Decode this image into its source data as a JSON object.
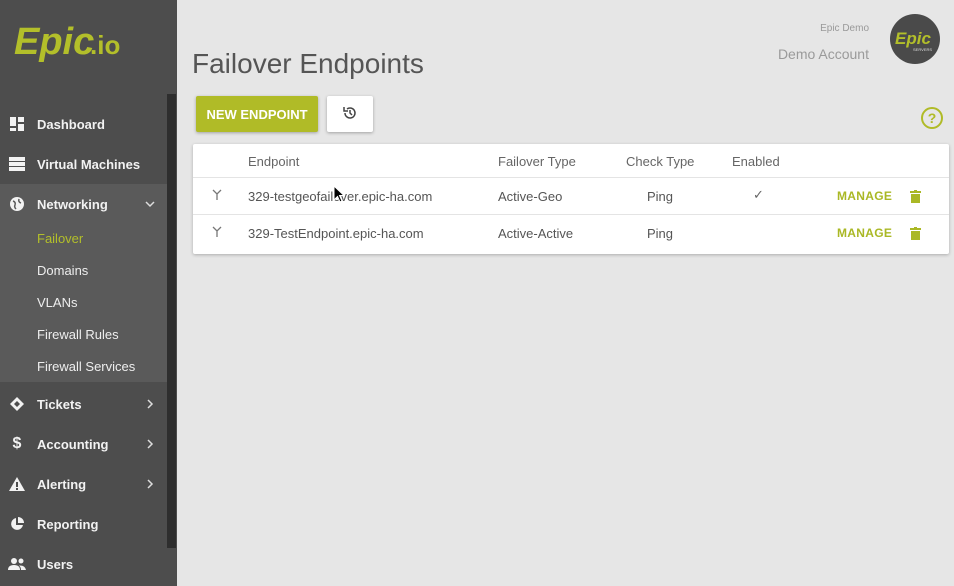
{
  "brand": {
    "logo_text": "Epic.io"
  },
  "sidebar": {
    "items": [
      {
        "label": "Dashboard",
        "icon": "dashboard-icon"
      },
      {
        "label": "Virtual Machines",
        "icon": "server-icon"
      },
      {
        "label": "Networking",
        "icon": "globe-icon",
        "expanded": true,
        "children": [
          {
            "label": "Failover",
            "active": true
          },
          {
            "label": "Domains"
          },
          {
            "label": "VLANs"
          },
          {
            "label": "Firewall Rules"
          },
          {
            "label": "Firewall Services"
          }
        ]
      },
      {
        "label": "Tickets",
        "icon": "ticket-icon"
      },
      {
        "label": "Accounting",
        "icon": "dollar-icon"
      },
      {
        "label": "Alerting",
        "icon": "warning-icon"
      },
      {
        "label": "Reporting",
        "icon": "pie-chart-icon"
      },
      {
        "label": "Users",
        "icon": "users-icon"
      }
    ]
  },
  "header": {
    "title": "Failover Endpoints",
    "account_org": "Epic Demo",
    "account_name": "Demo Account",
    "avatar_text": "Epic",
    "avatar_subtext": "SERVERS"
  },
  "toolbar": {
    "new_endpoint_label": "NEW ENDPOINT",
    "history_icon": "history-icon",
    "help_icon": "help-icon"
  },
  "table": {
    "columns": [
      "Endpoint",
      "Failover Type",
      "Check Type",
      "Enabled"
    ],
    "rows": [
      {
        "endpoint": "329-testgeofailover.epic-ha.com",
        "failover_type": "Active-Geo",
        "check_type": "Ping",
        "enabled": true,
        "enabled_mark": "✓",
        "action": "MANAGE"
      },
      {
        "endpoint": "329-TestEndpoint.epic-ha.com",
        "failover_type": "Active-Active",
        "check_type": "Ping",
        "enabled": false,
        "enabled_mark": "",
        "action": "MANAGE"
      }
    ]
  },
  "colors": {
    "accent": "#b0bb27",
    "sidebar_bg": "#4d4d4d",
    "main_bg": "#e6e6e6"
  }
}
